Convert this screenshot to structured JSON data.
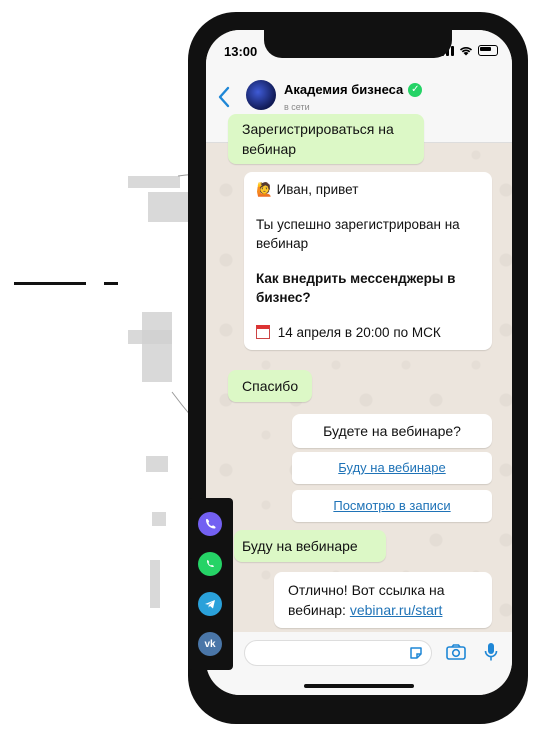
{
  "status": {
    "time": "13:00"
  },
  "chat": {
    "name": "Академия бизнеса",
    "status": "в сети"
  },
  "messages": {
    "m1": "Зарегистрироваться на вебинар",
    "m2_greeting": "Иван, привет",
    "m2_line": "Ты успешно зарегистрирован на вебинар",
    "m2_bold": "Как внедрить мессенджеры в бизнес?",
    "m2_date": "14 апреля в 20:00 по МСК",
    "m3": "Спасибо",
    "m4": "Будете на вебинаре?",
    "btn1": "Буду на вебинаре",
    "btn2": "Посмотрю в записи",
    "m5": "Буду на вебинаре",
    "m6_text": "Отлично! Вот ссылка на вебинар:",
    "m6_link": "vebinar.ru/start"
  },
  "icons": {
    "back": "chevron-left-icon",
    "verified": "verified-check-icon",
    "camera": "camera-icon",
    "mic": "microphone-icon",
    "sticker": "sticker-icon",
    "calendar": "calendar-icon",
    "wave": "waving-hand-icon"
  },
  "messenger_bar": [
    "viber-icon",
    "whatsapp-icon",
    "telegram-icon",
    "vk-icon"
  ],
  "colors": {
    "outgoing_bubble": "#dcf8c6",
    "incoming_bubble": "#ffffff",
    "link": "#1f73b7",
    "verified": "#25d366",
    "viber": "#7360f2",
    "whatsapp": "#25d366",
    "telegram": "#2aa1da",
    "vk": "#4a76a8"
  }
}
